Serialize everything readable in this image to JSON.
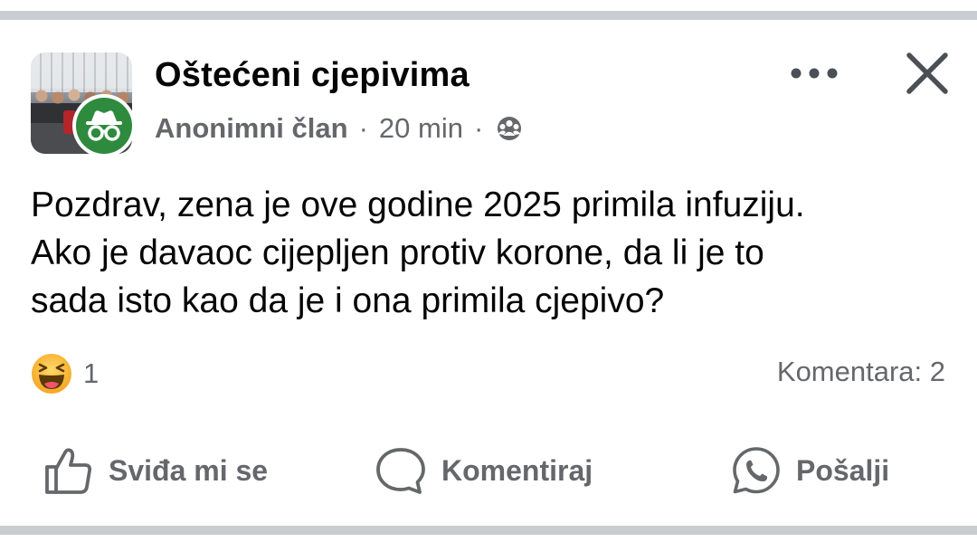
{
  "post": {
    "group_name": "Oštećeni cjepivima",
    "author": "Anonimni član",
    "separator": "·",
    "time": "20 min",
    "audience_icon": "group-audience-icon",
    "text_lines": [
      "Pozdrav, zena je ove godine 2025 primila infuziju.",
      "Ako je davaoc cijepljen protiv korone, da li je to",
      "sada isto kao da je i ona primila cjepivo?"
    ]
  },
  "header_controls": {
    "more_icon": "more-options-icon",
    "close_icon": "close-icon"
  },
  "reactions": {
    "type": "haha",
    "count": "1"
  },
  "comments": {
    "label": "Komentara: 2"
  },
  "actions": {
    "like_label": "Sviđa mi se",
    "comment_label": "Komentiraj",
    "send_label": "Pošalji"
  },
  "colors": {
    "text": "#050505",
    "secondary": "#65676b",
    "divider": "#c9ccd1",
    "anon_green": "#2e8b3e",
    "haha_yellow": "#f7b125"
  }
}
